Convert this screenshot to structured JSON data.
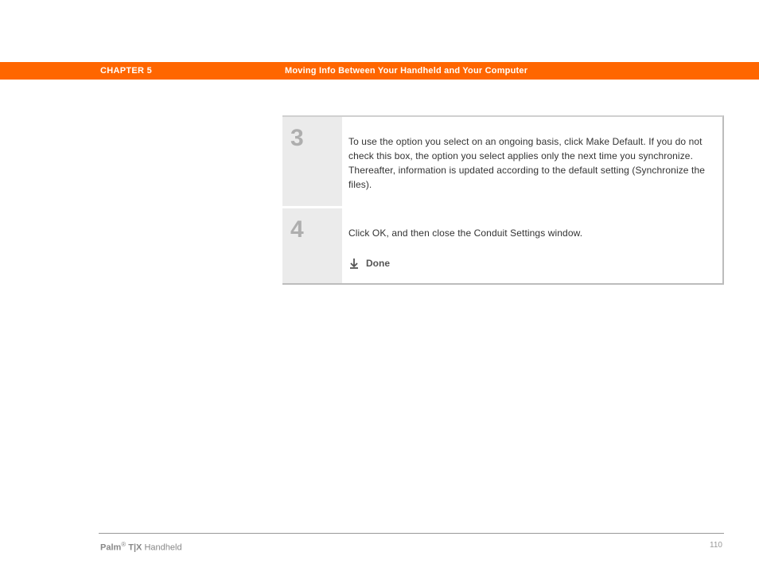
{
  "header": {
    "chapter_label": "CHAPTER 5",
    "chapter_title": "Moving Info Between Your Handheld and Your Computer"
  },
  "steps": [
    {
      "number": "3",
      "text": "To use the option you select on an ongoing basis, click Make Default. If you do not check this box, the option you select applies only the next time you synchronize. Thereafter, information is updated according to the default setting (Synchronize the files)."
    },
    {
      "number": "4",
      "text": "Click OK, and then close the Conduit Settings window.",
      "done_label": "Done"
    }
  ],
  "footer": {
    "brand": "Palm",
    "reg": "®",
    "model": " T|X",
    "suffix": " Handheld",
    "page_number": "110"
  }
}
